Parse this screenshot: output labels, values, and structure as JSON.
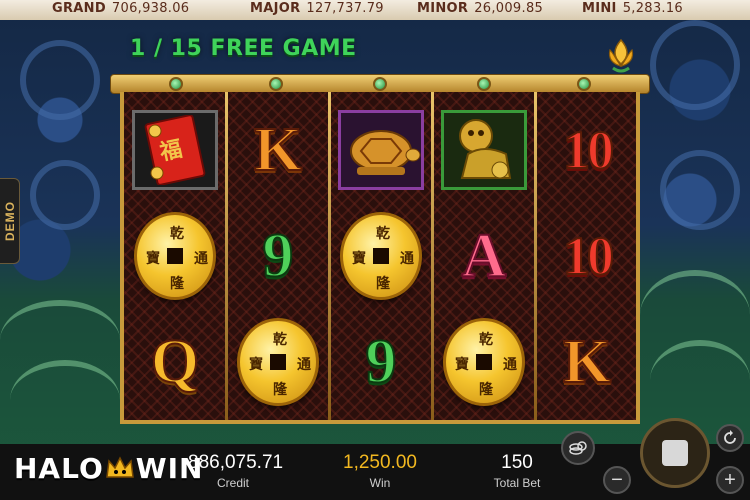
{
  "jackpots": [
    {
      "name": "GRAND",
      "value": "706,938.06"
    },
    {
      "name": "MAJOR",
      "value": "127,737.79"
    },
    {
      "name": "MINOR",
      "value": "26,009.85"
    },
    {
      "name": "MINI",
      "value": "5,283.16"
    }
  ],
  "demo_label": "DEMO",
  "free_game": {
    "current": "1",
    "total": "15",
    "label": "FREE GAME"
  },
  "reels": [
    [
      "envelope",
      "coin",
      "Q"
    ],
    [
      "K",
      "9",
      "coin"
    ],
    [
      "turtle",
      "coin",
      "9"
    ],
    [
      "lion",
      "A",
      "coin"
    ],
    [
      "10",
      "10",
      "K"
    ]
  ],
  "coin_chars": {
    "top": "乾",
    "left": "寶",
    "right": "通",
    "bottom": "隆"
  },
  "envelope_char": "福",
  "brand": {
    "part1": "HALO",
    "part2": "WIN"
  },
  "stats": {
    "credit": {
      "value": "886,075.71",
      "label": "Credit"
    },
    "win": {
      "value": "1,250.00",
      "label": "Win"
    },
    "total_bet": {
      "value": "150",
      "label": "Total Bet"
    }
  },
  "buttons": {
    "minus": "−",
    "plus": "+"
  },
  "colors": {
    "win": "#f2b820",
    "free_game": "#3fd35a",
    "frame_gold": "#c79a3b"
  }
}
